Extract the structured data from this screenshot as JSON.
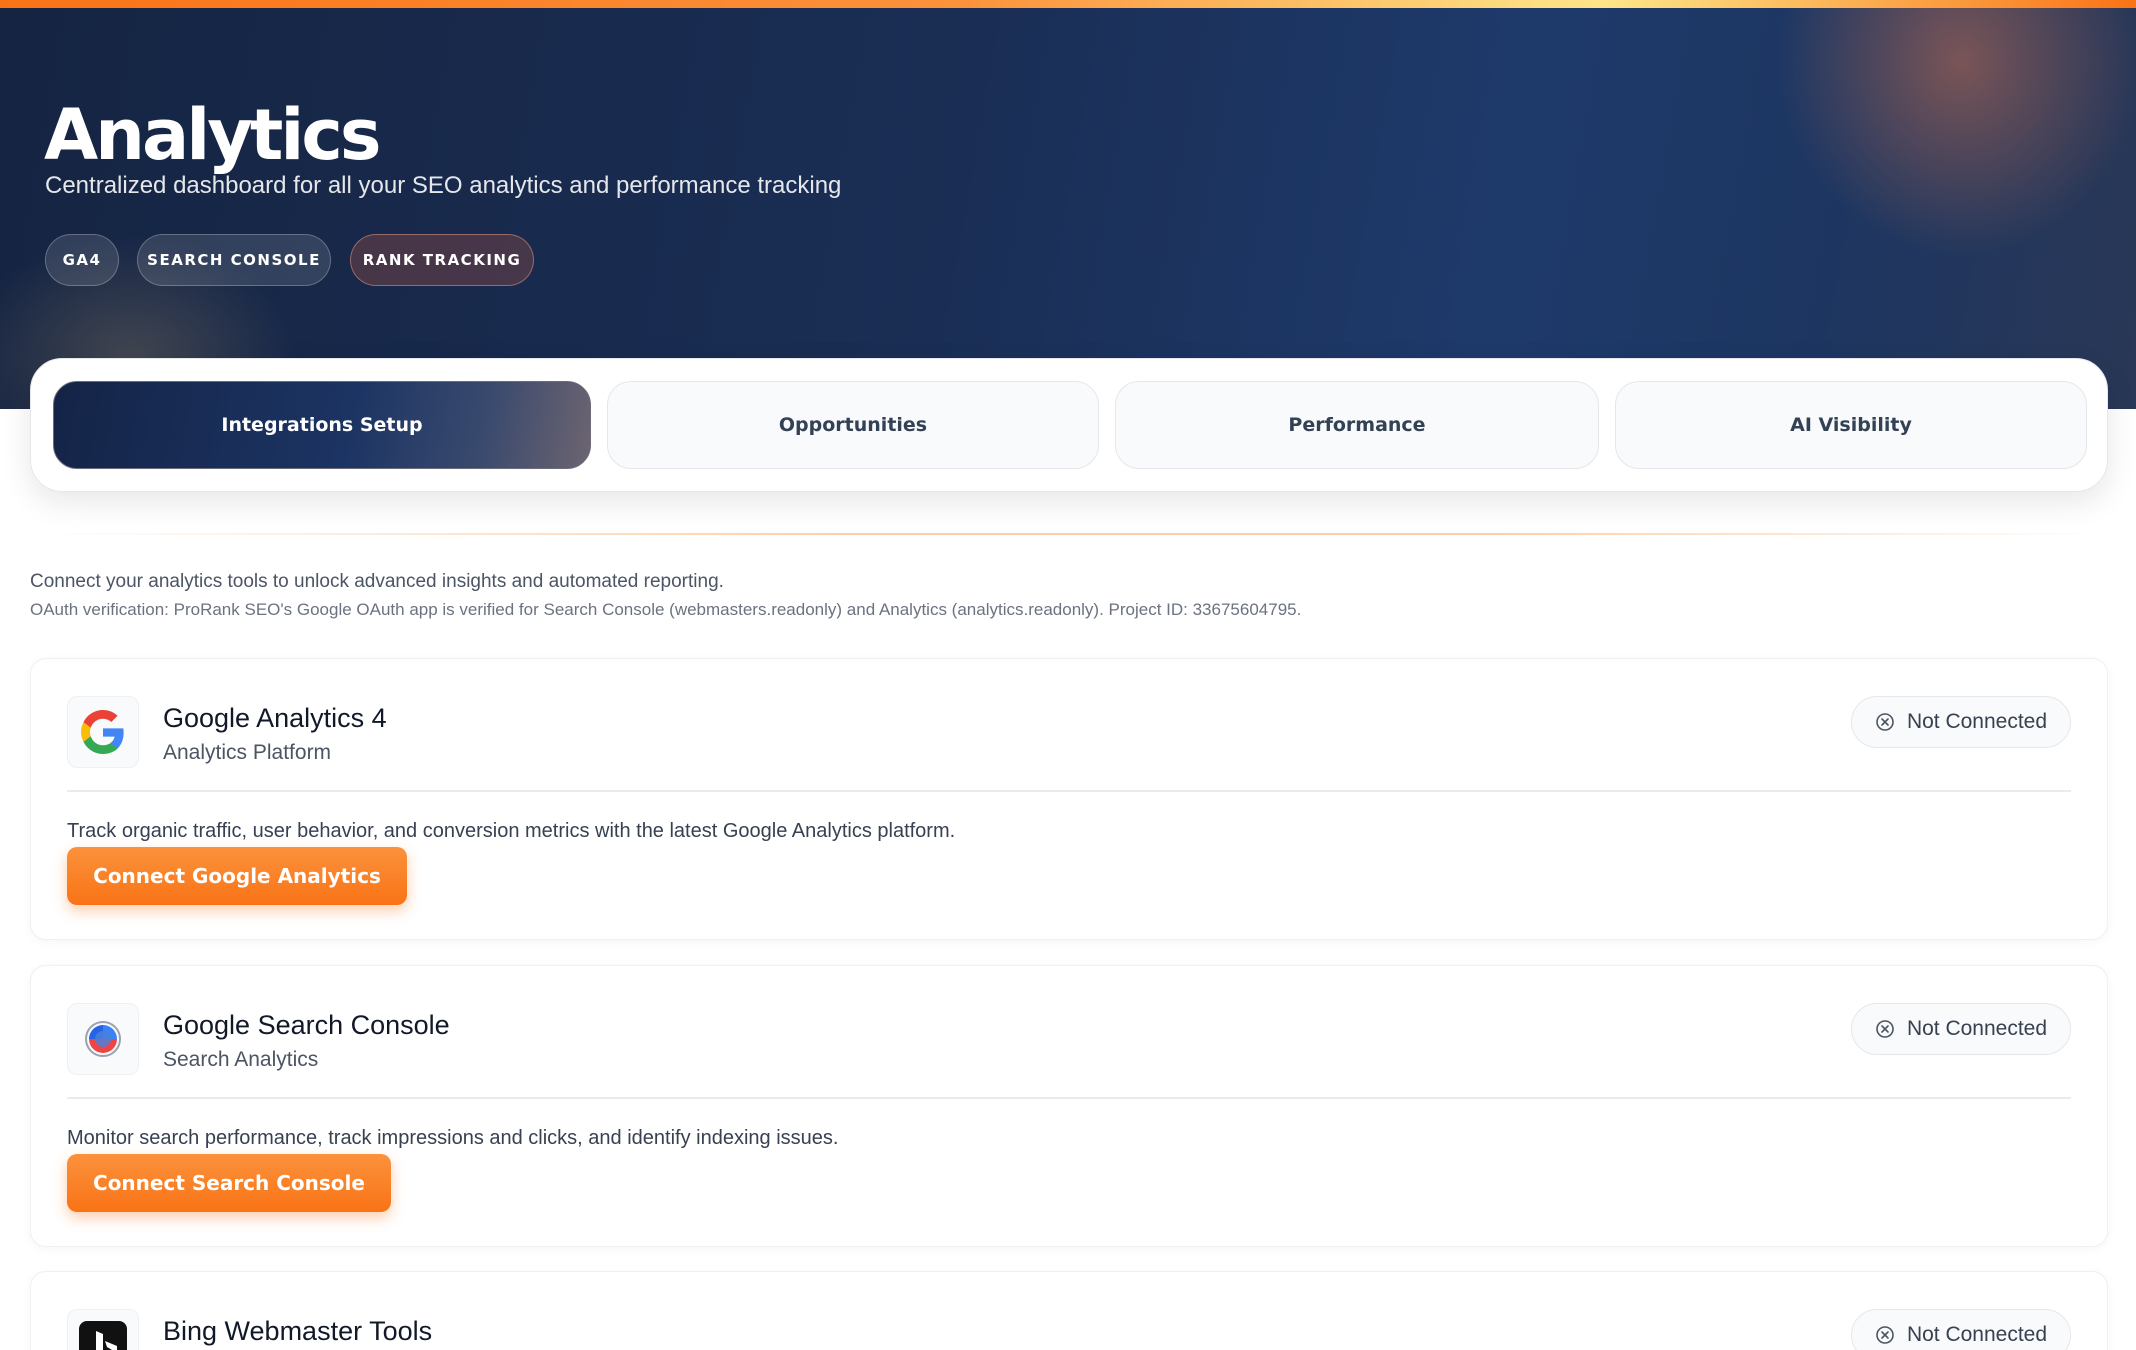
{
  "header": {
    "title": "Analytics",
    "subtitle": "Centralized dashboard for all your SEO analytics and performance tracking",
    "pills": [
      "GA4",
      "SEARCH CONSOLE",
      "RANK TRACKING"
    ]
  },
  "tabs": [
    {
      "label": "Integrations Setup",
      "active": true
    },
    {
      "label": "Opportunities",
      "active": false
    },
    {
      "label": "Performance",
      "active": false
    },
    {
      "label": "AI Visibility",
      "active": false
    }
  ],
  "intro": {
    "line1": "Connect your analytics tools to unlock advanced insights and automated reporting.",
    "line2": "OAuth verification: ProRank SEO's Google OAuth app is verified for Search Console (webmasters.readonly) and Analytics (analytics.readonly). Project ID: 33675604795."
  },
  "integrations": [
    {
      "name": "Google Analytics 4",
      "category": "Analytics Platform",
      "status": "Not Connected",
      "description": "Track organic traffic, user behavior, and conversion metrics with the latest Google Analytics platform.",
      "button": "Connect Google Analytics",
      "icon": "google-g-icon"
    },
    {
      "name": "Google Search Console",
      "category": "Search Analytics",
      "status": "Not Connected",
      "description": "Monitor search performance, track impressions and clicks, and identify indexing issues.",
      "button": "Connect Search Console",
      "icon": "search-console-icon"
    },
    {
      "name": "Bing Webmaster Tools",
      "status": "Not Connected",
      "icon": "bing-icon"
    }
  ],
  "colors": {
    "accent": "#f97316",
    "hero_dark": "#152442",
    "hero_blue": "#1e3a6b"
  }
}
